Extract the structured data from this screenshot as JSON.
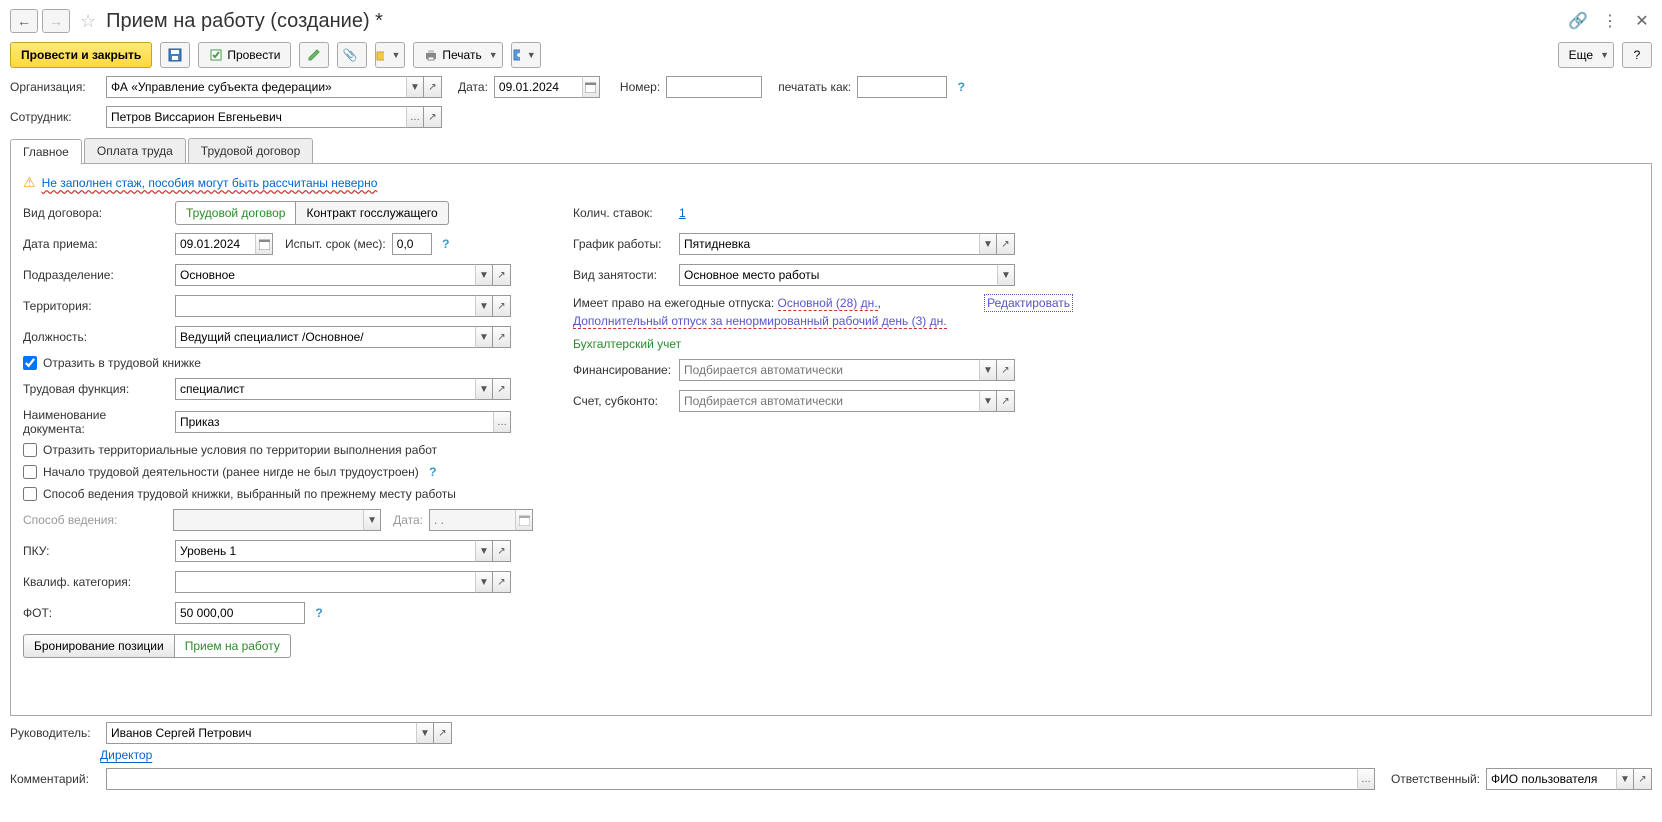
{
  "title": "Прием на работу (создание) *",
  "toolbar": {
    "post_close": "Провести и закрыть",
    "post": "Провести",
    "print": "Печать",
    "more": "Еще"
  },
  "header": {
    "org_label": "Организация:",
    "org_value": "ФА «Управление субъекта федерации»",
    "date_label": "Дата:",
    "date_value": "09.01.2024",
    "number_label": "Номер:",
    "print_as_label": "печатать как:",
    "employee_label": "Сотрудник:",
    "employee_value": "Петров Виссарион Евгеньевич"
  },
  "tabs": {
    "main": "Главное",
    "payment": "Оплата труда",
    "contract": "Трудовой договор"
  },
  "warning": "Не заполнен стаж, пособия могут быть рассчитаны неверно",
  "left": {
    "contract_type_label": "Вид договора:",
    "contract_type_labor": "Трудовой договор",
    "contract_type_gov": "Контракт госслужащего",
    "hire_date_label": "Дата приема:",
    "hire_date_value": "09.01.2024",
    "probation_label": "Испыт. срок (мес):",
    "probation_value": "0,0",
    "department_label": "Подразделение:",
    "department_value": "Основное",
    "territory_label": "Территория:",
    "position_label": "Должность:",
    "position_value": "Ведущий специалист /Основное/",
    "reflect_workbook": "Отразить в трудовой книжке",
    "labor_function_label": "Трудовая функция:",
    "labor_function_value": "специалист",
    "docname_label": "Наименование документа:",
    "docname_value": "Приказ",
    "cb_territorial": "Отразить территориальные условия по территории выполнения работ",
    "cb_first_job": "Начало трудовой деятельности (ранее нигде не был трудоустроен)",
    "cb_prev_method": "Способ ведения трудовой книжки, выбранный по прежнему месту работы",
    "method_label": "Способ ведения:",
    "method_date_label": "Дата:",
    "method_date_placeholder": ". .",
    "pku_label": "ПКУ:",
    "pku_value": "Уровень 1",
    "qual_label": "Квалиф. категория:",
    "fot_label": "ФОТ:",
    "fot_value": "50 000,00",
    "btn_booking": "Бронирование позиции",
    "btn_hire": "Прием на работу"
  },
  "right": {
    "rate_label": "Колич. ставок:",
    "rate_value": "1",
    "schedule_label": "График работы:",
    "schedule_value": "Пятидневка",
    "employment_label": "Вид занятости:",
    "employment_value": "Основное место работы",
    "vacation_prefix": "Имеет право на ежегодные отпуска: ",
    "vacation_main": "Основной (28) дн.",
    "vacation_sep": ", ",
    "vacation_extra": "Дополнительный отпуск за ненормированный рабочий день (3) дн.",
    "edit_link": "Редактировать",
    "accounting_section": "Бухгалтерский учет",
    "financing_label": "Финансирование:",
    "financing_placeholder": "Подбирается автоматически",
    "account_label": "Счет, субконто:",
    "account_placeholder": "Подбирается автоматически"
  },
  "footer": {
    "manager_label": "Руководитель:",
    "manager_value": "Иванов Сергей Петрович",
    "manager_position": "Директор",
    "comment_label": "Комментарий:",
    "responsible_label": "Ответственный:",
    "responsible_value": "ФИО пользователя"
  }
}
